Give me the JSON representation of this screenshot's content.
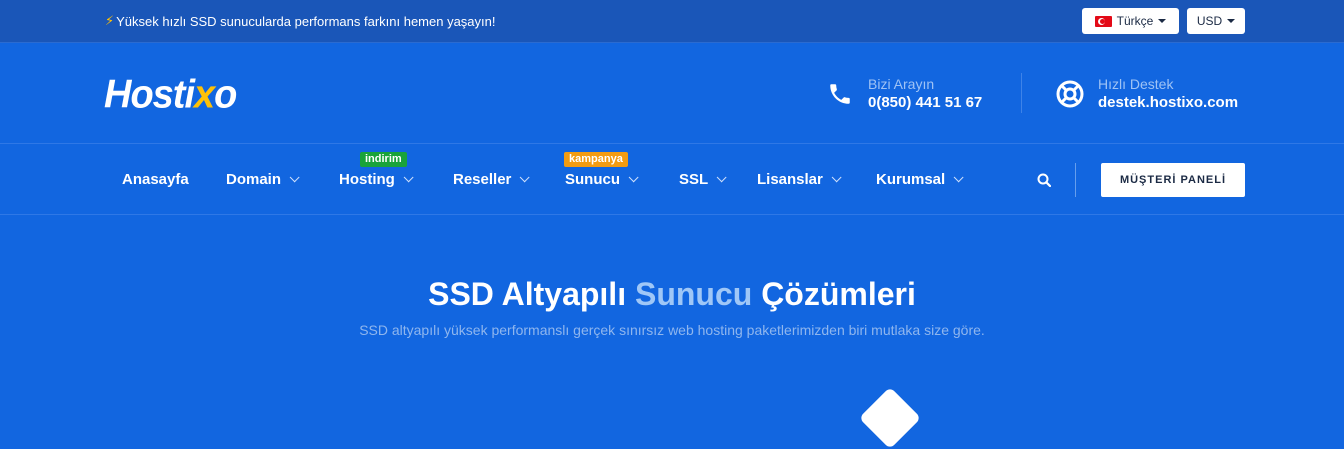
{
  "topbar": {
    "promo_text": "Yüksek hızlı SSD sunucularda performans farkını hemen yaşayın!",
    "language": "Türkçe",
    "currency": "USD"
  },
  "header": {
    "logo_text_a": "Hosti",
    "logo_text_b": "x",
    "logo_text_c": "o",
    "phone_label": "Bizi Arayın",
    "phone_number": "0(850) 441 51 67",
    "support_label": "Hızlı Destek",
    "support_email": "destek.hostixo.com"
  },
  "nav": {
    "items": [
      {
        "label": "Anasayfa"
      },
      {
        "label": "Domain"
      },
      {
        "label": "Hosting",
        "badge": "indirim"
      },
      {
        "label": "Reseller"
      },
      {
        "label": "Sunucu",
        "badge": "kampanya"
      },
      {
        "label": "SSL"
      },
      {
        "label": "Lisanslar"
      },
      {
        "label": "Kurumsal"
      }
    ],
    "panel_button": "MÜŞTERİ PANELİ"
  },
  "hero": {
    "title_a": "SSD Altyapılı ",
    "title_highlight": "Sunucu",
    "title_b": " Çözümleri",
    "subtitle": "SSD altyapılı yüksek performanslı gerçek sınırsız web hosting paketlerimizden biri mutlaka size göre."
  },
  "colors": {
    "primary": "#1266e0",
    "topbar": "#1a56b8",
    "accent": "#ffc107",
    "badge_green": "#19a33a",
    "badge_orange": "#f39c12"
  }
}
